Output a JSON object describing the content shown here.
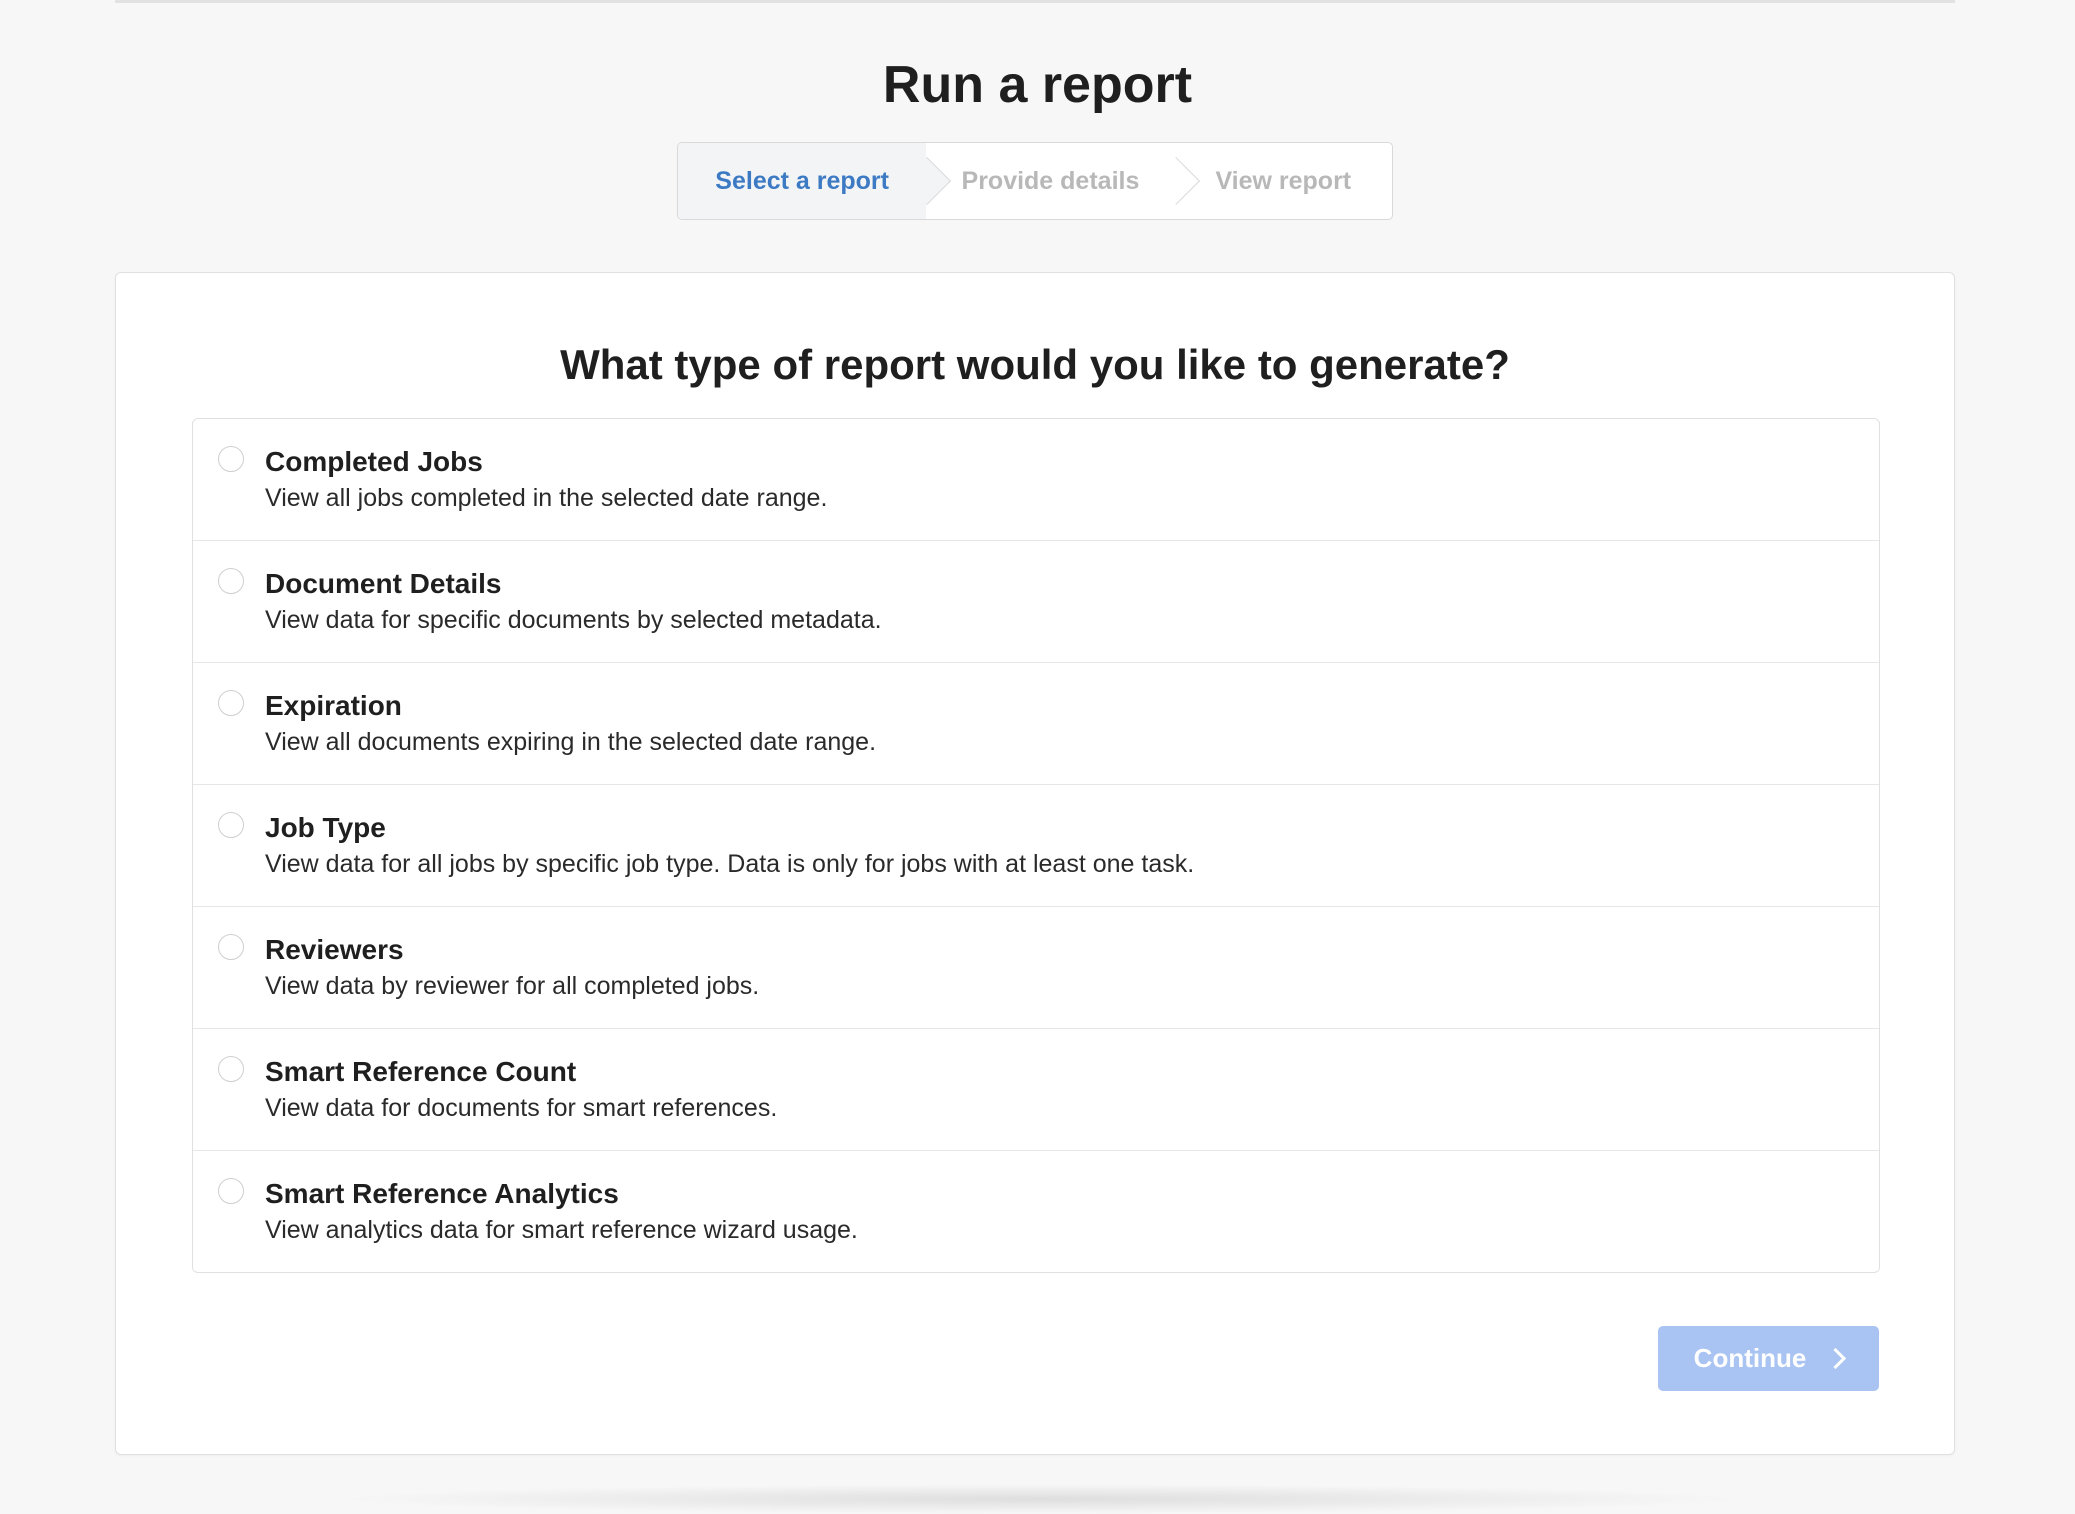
{
  "page": {
    "title": "Run a report"
  },
  "stepper": {
    "steps": [
      {
        "label": "Select a report",
        "state": "active"
      },
      {
        "label": "Provide details",
        "state": "inactive"
      },
      {
        "label": "View report",
        "state": "inactive"
      }
    ],
    "active_color": "#3d7ac4"
  },
  "card": {
    "heading": "What type of report would you like to generate?"
  },
  "options": [
    {
      "title": "Completed Jobs",
      "description": "View all jobs completed in the selected date range.",
      "selected": false
    },
    {
      "title": "Document Details",
      "description": "View data for specific documents by selected metadata.",
      "selected": false
    },
    {
      "title": "Expiration",
      "description": "View all documents expiring in the selected date range.",
      "selected": false
    },
    {
      "title": "Job Type",
      "description": "View data for all jobs by specific job type. Data is only for jobs with at least one task.",
      "selected": false
    },
    {
      "title": "Reviewers",
      "description": "View data by reviewer for all completed jobs.",
      "selected": false
    },
    {
      "title": "Smart Reference Count",
      "description": "View data for documents for smart references.",
      "selected": false
    },
    {
      "title": "Smart Reference Analytics",
      "description": "View analytics data for smart reference wizard usage.",
      "selected": false
    }
  ],
  "footer": {
    "continue_label": "Continue",
    "continue_icon": "chevron-right-icon",
    "continue_disabled": true,
    "continue_color": "#a9c4f2"
  }
}
